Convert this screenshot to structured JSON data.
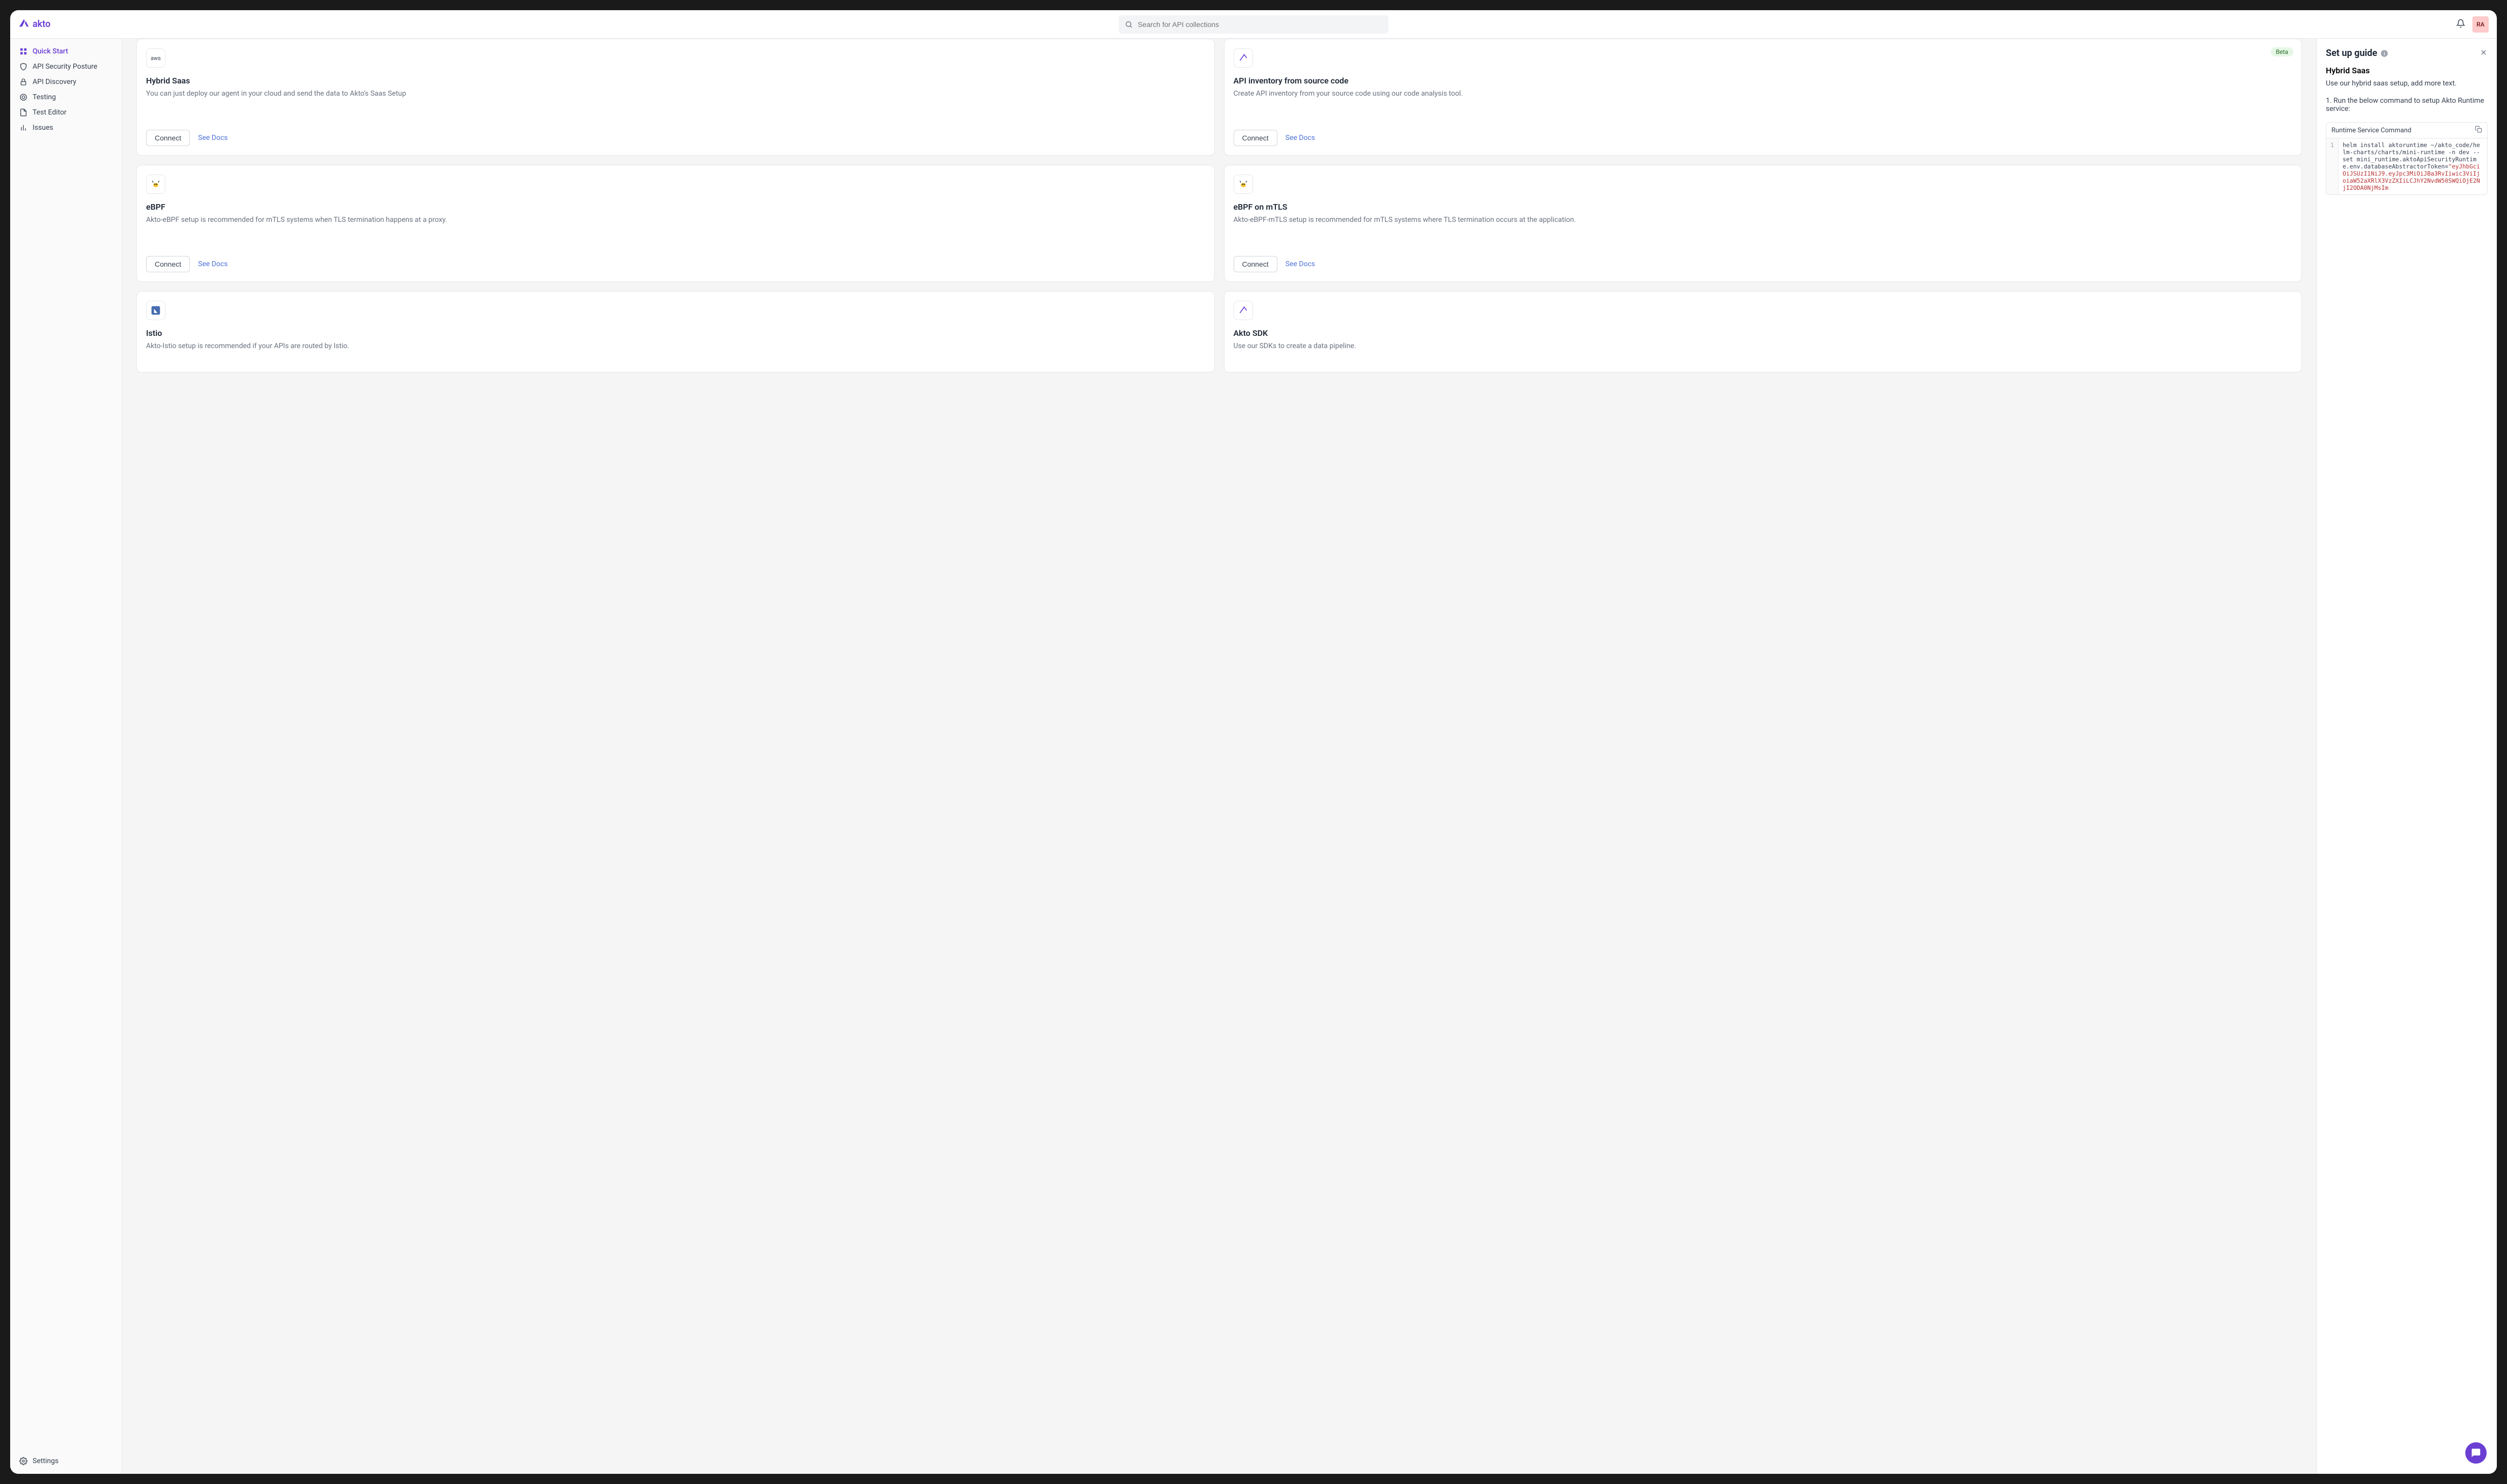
{
  "brand": "akto",
  "search_placeholder": "Search for API collections",
  "avatar_initials": "RA",
  "sidebar": {
    "items": [
      {
        "label": "Quick Start",
        "active": true
      },
      {
        "label": "API Security Posture"
      },
      {
        "label": "API Discovery"
      },
      {
        "label": "Testing"
      },
      {
        "label": "Test Editor"
      },
      {
        "label": "Issues"
      }
    ],
    "settings_label": "Settings"
  },
  "cards": [
    {
      "title": "Hybrid Saas",
      "desc": "You can just deploy our agent in your cloud and send the data to Akto's Saas Setup",
      "connect": "Connect",
      "docs": "See Docs",
      "icon": "aws"
    },
    {
      "title": "API inventory from source code",
      "desc": "Create API inventory from your source code using our code analysis tool.",
      "connect": "Connect",
      "docs": "See Docs",
      "badge": "Beta",
      "icon": "akto"
    },
    {
      "title": "eBPF",
      "desc": "Akto-eBPF setup is recommended for mTLS systems when TLS termination happens at a proxy.",
      "connect": "Connect",
      "docs": "See Docs",
      "icon": "bee"
    },
    {
      "title": "eBPF on mTLS",
      "desc": "Akto-eBPF-mTLS setup is recommended for mTLS systems where TLS termination occurs at the application.",
      "connect": "Connect",
      "docs": "See Docs",
      "icon": "bee"
    },
    {
      "title": "Istio",
      "desc": "Akto-Istio setup is recommended if your APIs are routed by Istio.",
      "icon": "istio"
    },
    {
      "title": "Akto SDK",
      "desc": "Use our SDKs to create a data pipeline.",
      "icon": "akto"
    }
  ],
  "panel": {
    "title": "Set up guide",
    "subtitle": "Hybrid Saas",
    "intro": "Use our hybrid saas setup, add more text.",
    "step": "1. Run the below command to setup Akto Runtime service:",
    "code_label": "Runtime Service Command",
    "code_line_num": "1",
    "code_plain": "helm install aktoruntime ~/akto_code/helm-charts/charts/mini-runtime -n dev       --set mini_runtime.aktoApiSecurityRuntime.env.databaseAbstractorToken=",
    "code_token": "\"eyJhbGciOiJSUzI1NiJ9.eyJpc3MiOiJBa3RvIiwic3ViIjoiaW52aXRlX3VzZXIiLCJhY2NvdW50SWQiOjE2NjI2ODA0NjMsIm"
  }
}
